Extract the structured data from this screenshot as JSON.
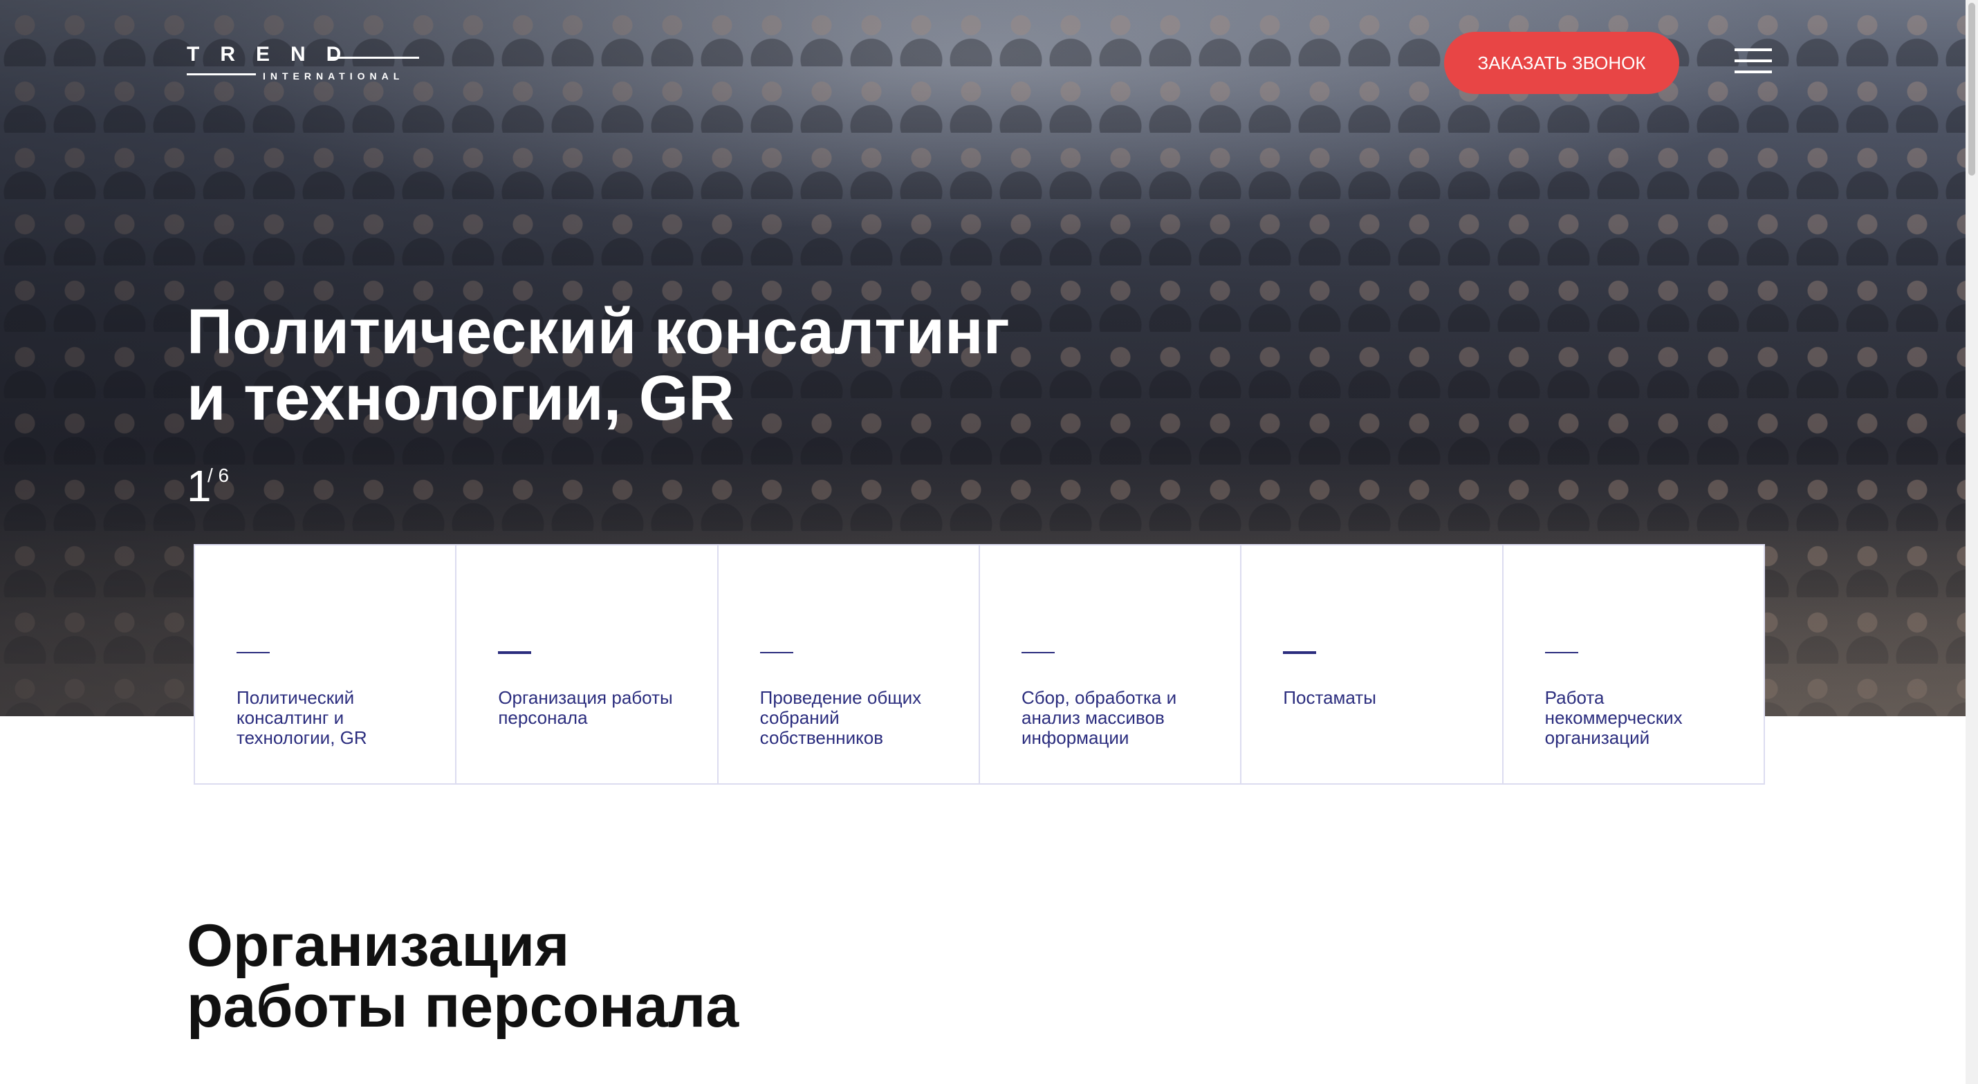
{
  "header": {
    "logo_main": "TREND",
    "logo_sub": "INTERNATIONAL",
    "call_button": "ЗАКАЗАТЬ ЗВОНОК"
  },
  "hero": {
    "title_line1": "Политический консалтинг",
    "title_line2": "и технологии, GR",
    "slide_current": "1",
    "slide_total": "/ 6"
  },
  "services": [
    {
      "label": "Политический консалтинг и технологии, GR",
      "active": false
    },
    {
      "label": "Организация работы персонала",
      "active": true
    },
    {
      "label": "Проведение общих собраний собственников",
      "active": false
    },
    {
      "label": "Сбор, обработка и анализ массивов информации",
      "active": false
    },
    {
      "label": "Постаматы",
      "active": true
    },
    {
      "label": "Работа некоммерческих организаций",
      "active": false
    }
  ],
  "section": {
    "title_line1": "Организация",
    "title_line2": "работы персонала"
  },
  "icons": {
    "menu": "hamburger-menu-icon"
  },
  "colors": {
    "accent": "#e84545",
    "service_text": "#2b2d7e",
    "card_border": "#dcdcf0"
  }
}
